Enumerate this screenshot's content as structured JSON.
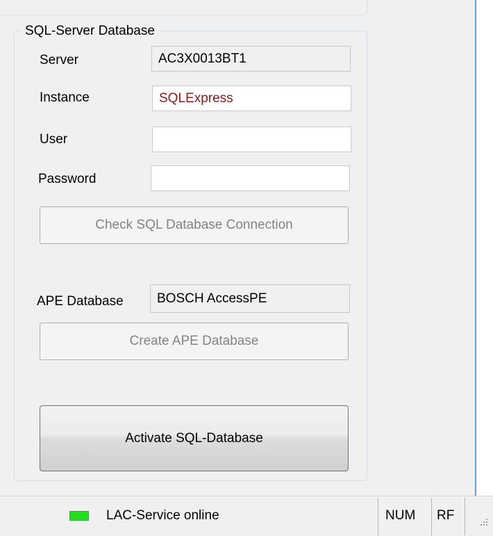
{
  "group": {
    "title": "SQL-Server Database"
  },
  "server": {
    "label": "Server",
    "value": "AC3X0013BT1"
  },
  "instance": {
    "label": "Instance",
    "value": "SQLExpress"
  },
  "user": {
    "label": "User",
    "value": ""
  },
  "password": {
    "label": "Password",
    "value": ""
  },
  "check_button": {
    "label": "Check SQL Database Connection",
    "enabled": false
  },
  "ape_database": {
    "label": "APE Database",
    "value": "BOSCH AccessPE"
  },
  "create_button": {
    "label": "Create APE Database",
    "enabled": false
  },
  "activate_button": {
    "label": "Activate SQL-Database"
  },
  "statusbar": {
    "service_text": "LAC-Service online",
    "service_indicator_color": "#22dd22",
    "num": "NUM",
    "rf": "RF"
  },
  "colors": {
    "instance_text": "#8b1a1a",
    "accent_border": "#6b9ccf"
  }
}
